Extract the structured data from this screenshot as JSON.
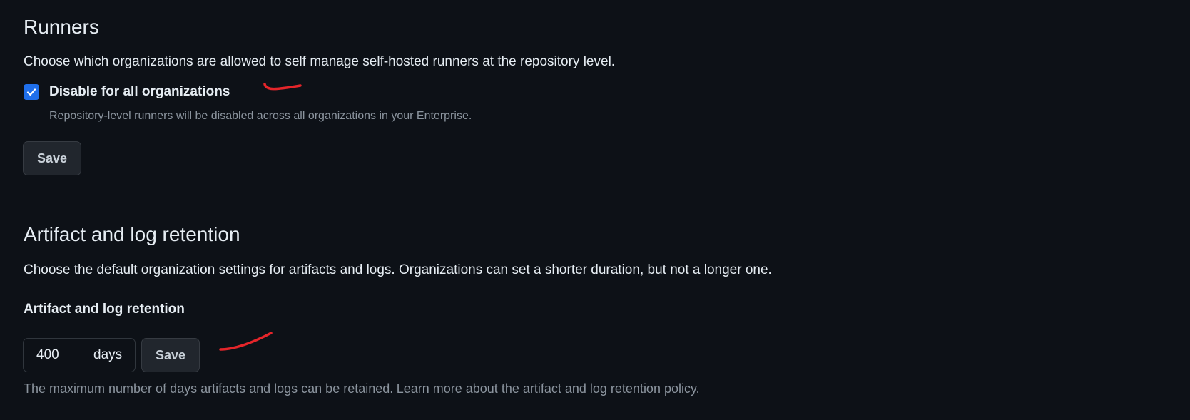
{
  "runners": {
    "heading": "Runners",
    "description": "Choose which organizations are allowed to self manage self-hosted runners at the repository level.",
    "checkbox_label": "Disable for all organizations",
    "checkbox_checked": true,
    "checkbox_note": "Repository-level runners will be disabled across all organizations in your Enterprise.",
    "save_label": "Save"
  },
  "retention": {
    "heading": "Artifact and log retention",
    "description": "Choose the default organization settings for artifacts and logs. Organizations can set a shorter duration, but not a longer one.",
    "field_label": "Artifact and log retention",
    "days_value": "400",
    "days_suffix": "days",
    "save_label": "Save",
    "footer_text": "The maximum number of days artifacts and logs can be retained.",
    "footer_link": "Learn more about the artifact and log retention policy."
  },
  "colors": {
    "background": "#0d1117",
    "accent": "#1f6feb",
    "link": "#4493f8",
    "annotation_mark": "#e5252a"
  },
  "icons": {
    "checkbox": "check-icon"
  }
}
